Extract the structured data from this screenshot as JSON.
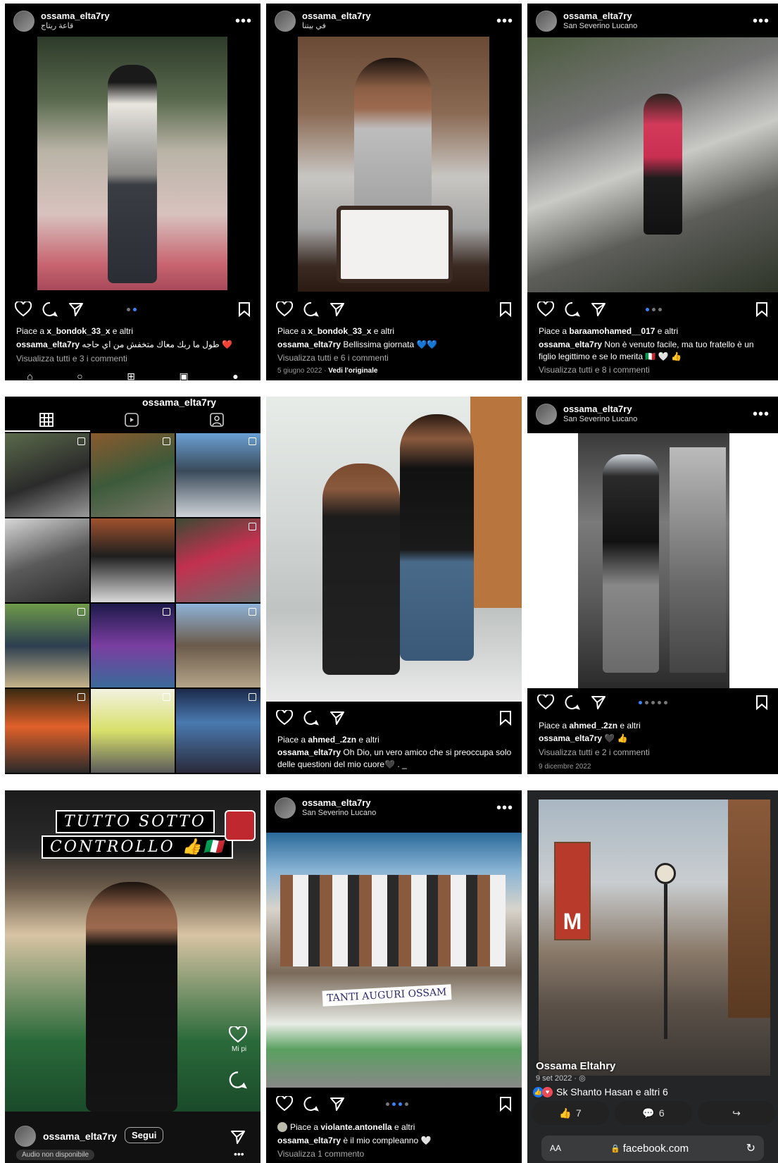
{
  "t1": {
    "username": "ossama_elta7ry",
    "location": "قاعة ريتاج",
    "liked_prefix": "Piace a ",
    "liked_user": "x_bondok_33_x",
    "liked_suffix": " e altri",
    "caption_user": "ossama_elta7ry",
    "caption_text": " طول ما ربك معاك متخفش من اي حاجه ❤️",
    "comments": "Visualizza tutti e 3 i commenti"
  },
  "t2": {
    "username": "ossama_elta7ry",
    "location": "في بيتنا",
    "liked_prefix": "Piace a ",
    "liked_user": "x_bondok_33_x",
    "liked_suffix": " e altri",
    "caption_user": "ossama_elta7ry",
    "caption_text": " Bellissima giornata 💙💙",
    "comments": "Visualizza tutti e 6 i commenti",
    "date": "5 giugno 2022 · ",
    "original": "Vedi l'originale"
  },
  "t3": {
    "username": "ossama_elta7ry",
    "location": "San Severino Lucano",
    "liked_prefix": "Piace a ",
    "liked_user": "baraamohamed__017",
    "liked_suffix": " e altri",
    "caption_user": "ossama_elta7ry",
    "caption_text": " Non è venuto facile, ma tuo fratello è un figlio legittimo e se lo merita 🇮🇹 🤍 👍",
    "comments": "Visualizza tutti e 8 i commenti"
  },
  "t4": {
    "profile_name": "ossama_elta7ry"
  },
  "t5": {
    "liked_prefix": "Piace a ",
    "liked_user": "ahmed_.2zn",
    "liked_suffix": " e altri",
    "caption_user": "ossama_elta7ry",
    "caption_text": " Oh Dio, un vero amico che si preoccupa solo delle questioni del mio cuore🖤 . _"
  },
  "t6": {
    "username": "ossama_elta7ry",
    "location": "San Severino Lucano",
    "liked_prefix": "Piace a ",
    "liked_user": "ahmed_.2zn",
    "liked_suffix": " e altri",
    "caption_user": "ossama_elta7ry",
    "caption_text": " 🖤 👍",
    "comments": "Visualizza tutti e 2 i commenti",
    "date": "9 dicembre 2022"
  },
  "t7": {
    "overlay_line1": "TUTTO SOTTO",
    "overlay_line2": "CONTROLLO 👍🇮🇹",
    "side_label": "Mi pi",
    "username": "ossama_elta7ry",
    "follow": "Segui",
    "audio": "Audio non disponibile"
  },
  "t8": {
    "username": "ossama_elta7ry",
    "location": "San Severino Lucano",
    "banner": "TANTI AUGURI OSSAM",
    "liked_prefix": "Piace a ",
    "liked_user": "violante.antonella",
    "liked_suffix": " e altri",
    "caption_user": "ossama_elta7ry",
    "caption_text": " è il mio compleanno 🤍",
    "comments": "Visualizza 1 commento"
  },
  "t9": {
    "name": "Ossama Eltahry",
    "date": "9 set 2022 · ",
    "reactions": "Sk Shanto Hasan e altri 6",
    "likes": "7",
    "comments": "6",
    "aa": "AA",
    "url": "facebook.com",
    "sign": "M"
  },
  "colors": {
    "background": "#000000",
    "accent": "#3b82f6",
    "like_heart": "#ed4956",
    "fb_blue": "#1877f2"
  }
}
